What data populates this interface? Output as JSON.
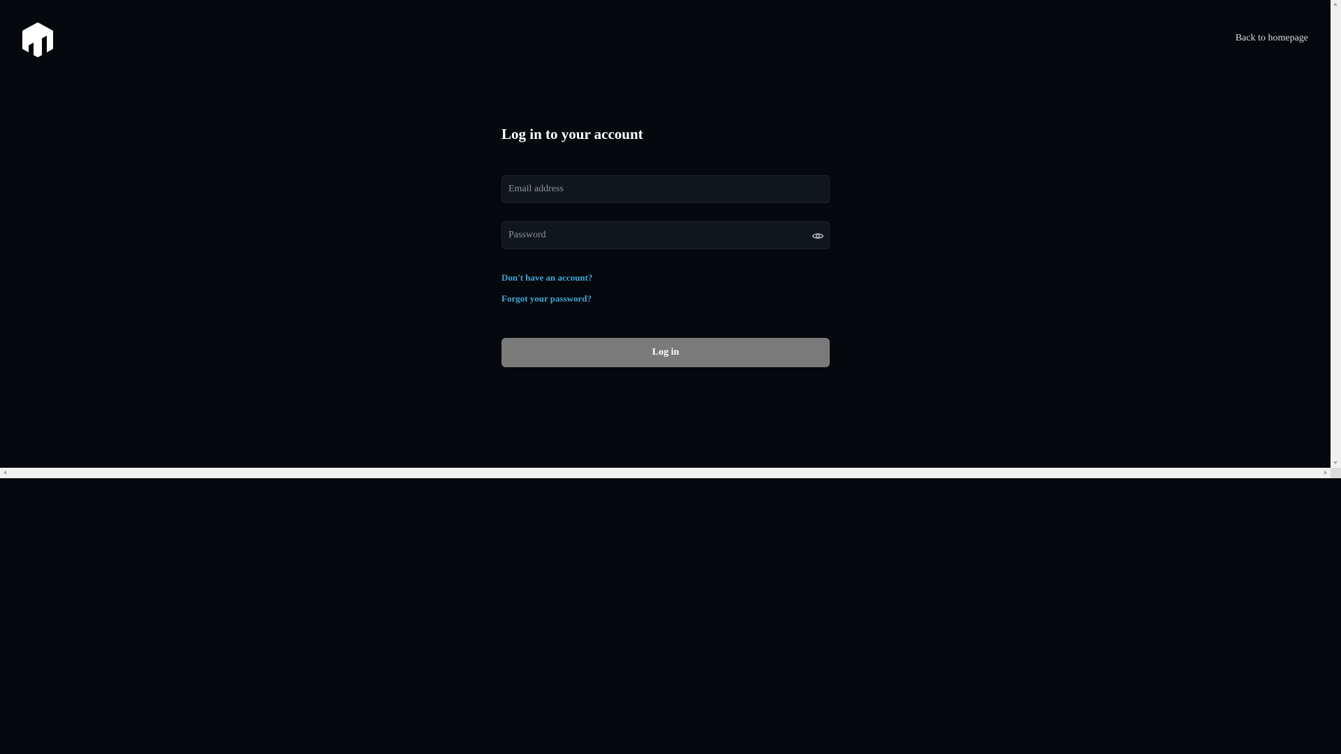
{
  "header": {
    "logo_icon": "bar-chart-building-logo-icon",
    "back_link": "Back to homepage"
  },
  "login": {
    "title": "Log in to your account",
    "email": {
      "placeholder": "Email address",
      "value": ""
    },
    "password": {
      "placeholder": "Password",
      "value": "",
      "toggle_icon": "eye-icon"
    },
    "signup_link": "Don't have an account?",
    "forgot_link": "Forgot your password?",
    "submit_label": "Log in"
  },
  "colors": {
    "background": "#05080c",
    "link": "#3fa7d6",
    "button": "#7a7a7a",
    "input_bg": "#11161c"
  }
}
